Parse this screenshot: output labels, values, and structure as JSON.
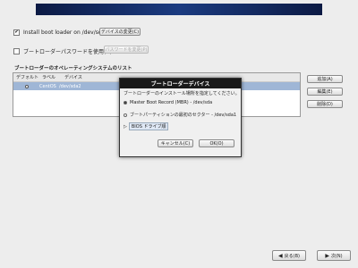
{
  "install_checkbox": {
    "checked": true,
    "label": "Install boot loader on /dev/sda."
  },
  "change_device_button": "デバイスの変更(C)",
  "password_checkbox": {
    "checked": false,
    "label": "ブートローダーパスワードを使用(U)"
  },
  "change_password_button": "パスワードを変更(P)",
  "os_list": {
    "title": "ブートローダーのオペレーティングシステムのリスト",
    "columns": [
      "デフォルト",
      "ラベル",
      "デバイス"
    ],
    "rows": [
      {
        "default": true,
        "label": "CentOS",
        "device": "/dev/sda2"
      }
    ]
  },
  "side_buttons": {
    "add": "追加(A)",
    "edit": "編集(E)",
    "delete": "削除(D)"
  },
  "dialog": {
    "title": "ブートローダーデバイス",
    "prompt": "ブートローダーのインストール場所を指定してください。",
    "option_mbr": "Master Boot Record (MBR) - /dev/sda",
    "option_partition": "ブートパーティションの最初のセクター - /dev/sda1",
    "bios_order": "BIOS ドライブ順",
    "cancel": "キャンセル(C)",
    "ok": "OK(O)"
  },
  "nav": {
    "back": "戻る(B)",
    "next": "次(N)"
  }
}
